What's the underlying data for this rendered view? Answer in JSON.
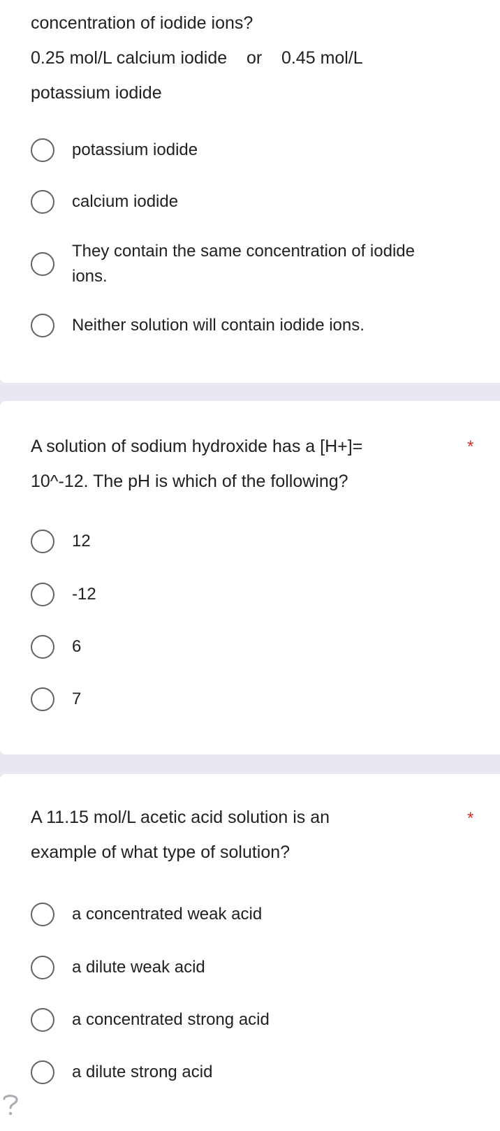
{
  "questions": [
    {
      "lines": [
        "concentration of iodide ions?",
        "0.25 mol/L calcium iodide    or    0.45 mol/L",
        "potassium iodide"
      ],
      "required_mark": "",
      "options": [
        {
          "label": "potassium iodide"
        },
        {
          "label": "calcium iodide"
        },
        {
          "label": "They contain the same concentration of iodide ions."
        },
        {
          "label": "Neither solution will contain iodide ions."
        }
      ]
    },
    {
      "lines": [
        "A solution of sodium hydroxide has a [H+]=",
        "10^-12. The pH is which of the following?"
      ],
      "required_mark": "*",
      "options": [
        {
          "label": "12"
        },
        {
          "label": "-12"
        },
        {
          "label": "6"
        },
        {
          "label": "7"
        }
      ]
    },
    {
      "lines": [
        "A 11.15 mol/L acetic acid solution is an",
        "example of what type of solution?"
      ],
      "required_mark": "*",
      "options": [
        {
          "label": "a concentrated weak acid"
        },
        {
          "label": "a dilute weak acid"
        },
        {
          "label": "a concentrated strong acid"
        },
        {
          "label": "a dilute strong acid"
        }
      ]
    }
  ],
  "help_icon": "help-circle-icon",
  "colors": {
    "background": "#e9e7f1",
    "card": "#ffffff",
    "required": "#d93025",
    "radio_border": "#5f6368"
  }
}
